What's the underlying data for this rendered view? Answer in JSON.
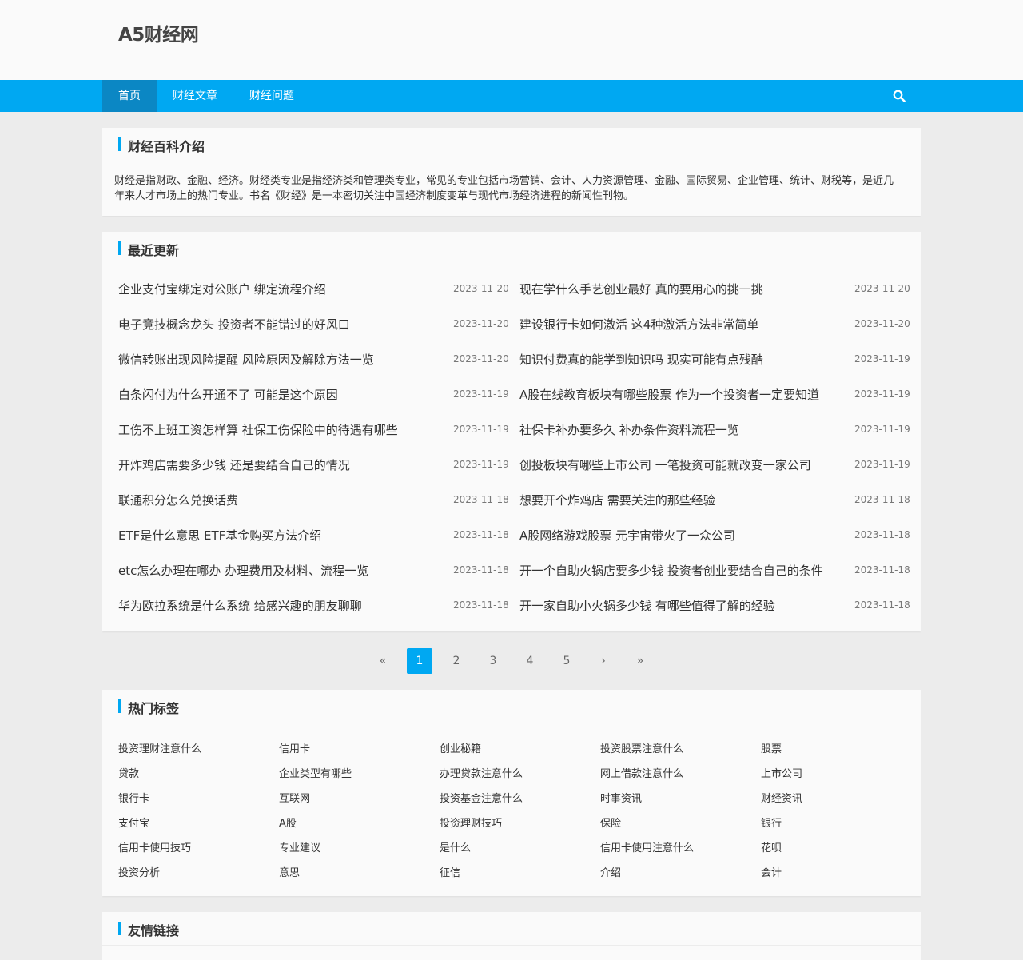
{
  "site": {
    "logo": "A5财经网"
  },
  "nav": {
    "items": [
      "首页",
      "财经文章",
      "财经问题"
    ],
    "search_icon": "search-icon"
  },
  "intro": {
    "title": "财经百科介绍",
    "text": "财经是指财政、金融、经济。财经类专业是指经济类和管理类专业，常见的专业包括市场营销、会计、人力资源管理、金融、国际贸易、企业管理、统计、财税等，是近几年来人才市场上的热门专业。书名《财经》是一本密切关注中国经济制度变革与现代市场经济进程的新闻性刊物。"
  },
  "updates": {
    "title": "最近更新",
    "left": [
      {
        "title": "企业支付宝绑定对公账户 绑定流程介绍",
        "date": "2023-11-20"
      },
      {
        "title": "电子竞技概念龙头 投资者不能错过的好风口",
        "date": "2023-11-20"
      },
      {
        "title": "微信转账出现风险提醒 风险原因及解除方法一览",
        "date": "2023-11-20"
      },
      {
        "title": "白条闪付为什么开通不了 可能是这个原因",
        "date": "2023-11-19"
      },
      {
        "title": "工伤不上班工资怎样算 社保工伤保险中的待遇有哪些",
        "date": "2023-11-19"
      },
      {
        "title": "开炸鸡店需要多少钱 还是要结合自己的情况",
        "date": "2023-11-19"
      },
      {
        "title": "联通积分怎么兑换话费",
        "date": "2023-11-18"
      },
      {
        "title": "ETF是什么意思 ETF基金购买方法介绍",
        "date": "2023-11-18"
      },
      {
        "title": "etc怎么办理在哪办 办理费用及材料、流程一览",
        "date": "2023-11-18"
      },
      {
        "title": "华为欧拉系统是什么系统 给感兴趣的朋友聊聊",
        "date": "2023-11-18"
      }
    ],
    "right": [
      {
        "title": "现在学什么手艺创业最好 真的要用心的挑一挑",
        "date": "2023-11-20"
      },
      {
        "title": "建设银行卡如何激活 这4种激活方法非常简单",
        "date": "2023-11-20"
      },
      {
        "title": "知识付费真的能学到知识吗 现实可能有点残酷",
        "date": "2023-11-19"
      },
      {
        "title": "A股在线教育板块有哪些股票 作为一个投资者一定要知道",
        "date": "2023-11-19"
      },
      {
        "title": "社保卡补办要多久 补办条件资料流程一览",
        "date": "2023-11-19"
      },
      {
        "title": "创投板块有哪些上市公司 一笔投资可能就改变一家公司",
        "date": "2023-11-19"
      },
      {
        "title": "想要开个炸鸡店 需要关注的那些经验",
        "date": "2023-11-18"
      },
      {
        "title": "A股网络游戏股票 元宇宙带火了一众公司",
        "date": "2023-11-18"
      },
      {
        "title": "开一个自助火锅店要多少钱 投资者创业要结合自己的条件",
        "date": "2023-11-18"
      },
      {
        "title": "开一家自助小火锅多少钱 有哪些值得了解的经验",
        "date": "2023-11-18"
      }
    ]
  },
  "pagination": {
    "first": "«",
    "pages": [
      "1",
      "2",
      "3",
      "4",
      "5"
    ],
    "next": "›",
    "last": "»",
    "current": "1"
  },
  "tags": {
    "title": "热门标签",
    "items": [
      "投资理财注意什么",
      "信用卡",
      "创业秘籍",
      "投资股票注意什么",
      "股票",
      "贷款",
      "企业类型有哪些",
      "办理贷款注意什么",
      "网上借款注意什么",
      "上市公司",
      "银行卡",
      "互联网",
      "投资基金注意什么",
      "时事资讯",
      "财经资讯",
      "支付宝",
      "A股",
      "投资理财技巧",
      "保险",
      "银行",
      "信用卡使用技巧",
      "专业建议",
      "是什么",
      "信用卡使用注意什么",
      "花呗",
      "投资分析",
      "意思",
      "征信",
      "介绍",
      "会计"
    ]
  },
  "links": {
    "title": "友情链接"
  },
  "colors": {
    "accent": "#00a8f2",
    "nav_active": "#0b87c4",
    "page_bg": "#ececec",
    "panel_bg": "#fafafa"
  }
}
